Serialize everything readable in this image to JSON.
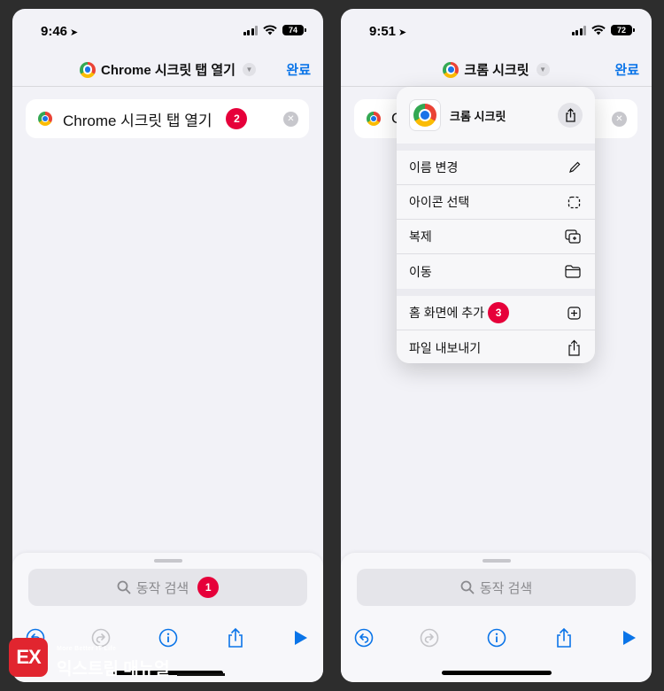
{
  "left_screen": {
    "status": {
      "time": "9:46",
      "battery": "74"
    },
    "nav": {
      "title": "Chrome 시크릿 탭 열기",
      "done": "완료"
    },
    "title_field": {
      "value": "Chrome 시크릿 탭 열기",
      "step_badge": "2"
    },
    "search": {
      "placeholder": "동작 검색",
      "step_badge": "1"
    }
  },
  "right_screen": {
    "status": {
      "time": "9:51",
      "battery": "72"
    },
    "nav": {
      "title": "크롬 시크릿",
      "done": "완료"
    },
    "title_field": {
      "value_visible": "C"
    },
    "menu": {
      "header_name": "크롬 시크릿",
      "group1": [
        {
          "label": "이름 변경",
          "icon": "pencil-icon"
        },
        {
          "label": "아이콘 선택",
          "icon": "dashed-square-icon"
        },
        {
          "label": "복제",
          "icon": "duplicate-icon"
        },
        {
          "label": "이동",
          "icon": "folder-icon"
        }
      ],
      "group2": [
        {
          "label": "홈 화면에 추가",
          "icon": "plus-square-icon",
          "step_badge": "3"
        },
        {
          "label": "파일 내보내기",
          "icon": "share-icon"
        }
      ]
    },
    "search": {
      "placeholder": "동작 검색"
    }
  },
  "watermark": {
    "logo_text": "EX",
    "tagline": "More Better IT Life",
    "name": "익스트림 매뉴얼"
  },
  "colors": {
    "accent_blue": "#0a74e8",
    "badge_red": "#e6003a",
    "background": "#f2f2f7",
    "brand_red": "#e1252f"
  }
}
